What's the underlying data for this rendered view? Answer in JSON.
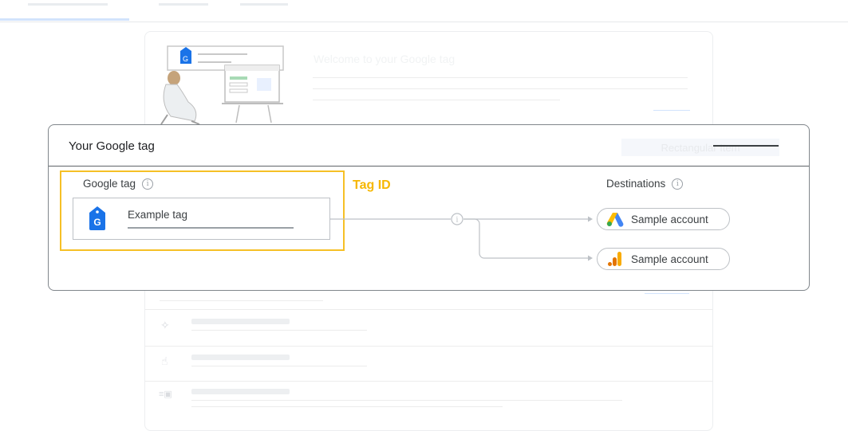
{
  "background": {
    "welcome_title": "Welcome to your Google tag",
    "rename_button": "Rectangular Item"
  },
  "modal": {
    "title": "Your Google tag",
    "google_tag_label": "Google tag",
    "tag_name": "Example tag",
    "tag_id_label": "Tag ID",
    "destinations_label": "Destinations",
    "destinations": [
      {
        "name": "Sample account",
        "logo": "google-ads-logo"
      },
      {
        "name": "Sample account",
        "logo": "google-analytics-logo"
      }
    ]
  },
  "colors": {
    "highlight": "#f6c026",
    "tag_id": "#f6b700",
    "tag_blue": "#1a73e8",
    "ads_blue": "#4285f4",
    "ads_yellow": "#fbbc04",
    "ads_green": "#34a853",
    "analytics_orange": "#f9ab00",
    "analytics_dark": "#e37400"
  }
}
